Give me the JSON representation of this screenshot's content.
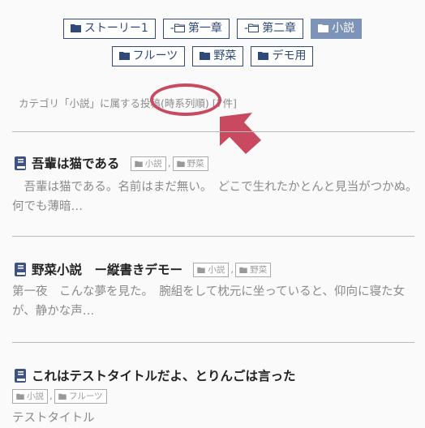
{
  "categories": {
    "row1": [
      {
        "label": "ストーリー1",
        "prefix": "",
        "icon": "folder-filled-icon",
        "active": false
      },
      {
        "label": "第一章",
        "prefix": "-",
        "icon": "folder-outline-icon",
        "active": false
      },
      {
        "label": "第二章",
        "prefix": "-",
        "icon": "folder-outline-icon",
        "active": false
      },
      {
        "label": "小説",
        "prefix": "",
        "icon": "folder-filled-icon",
        "active": true
      }
    ],
    "row2": [
      {
        "label": "フルーツ",
        "prefix": "",
        "icon": "folder-filled-icon",
        "active": false
      },
      {
        "label": "野菜",
        "prefix": "",
        "icon": "folder-filled-icon",
        "active": false
      },
      {
        "label": "デモ用",
        "prefix": "",
        "icon": "folder-filled-icon",
        "active": false
      }
    ]
  },
  "summary": "カテゴリ「小説」に属する投稿(時系列順) [7件]",
  "annotation": {
    "color": "#c94a60"
  },
  "posts": [
    {
      "title": "吾輩は猫である",
      "tags": [
        "小説",
        "野菜"
      ],
      "excerpt": "　吾輩は猫である。名前はまだ無い。　どこで生れたかとんと見当がつかぬ。何でも薄暗…"
    },
    {
      "title": "野菜小説　ー縦書きデモー",
      "tags": [
        "小説",
        "野菜"
      ],
      "excerpt": "第一夜　こんな夢を見た。　腕組をして枕元に坐っていると、仰向に寝た女が、静かな声…"
    },
    {
      "title": "これはテストタイトルだよ、とりんごは言った",
      "tags": [
        "小説",
        "フルーツ"
      ],
      "excerpt": "テストタイトル"
    }
  ],
  "colors": {
    "accent": "#2f4a78",
    "active_bg": "#7d93b7",
    "muted": "#8a8a8a"
  }
}
